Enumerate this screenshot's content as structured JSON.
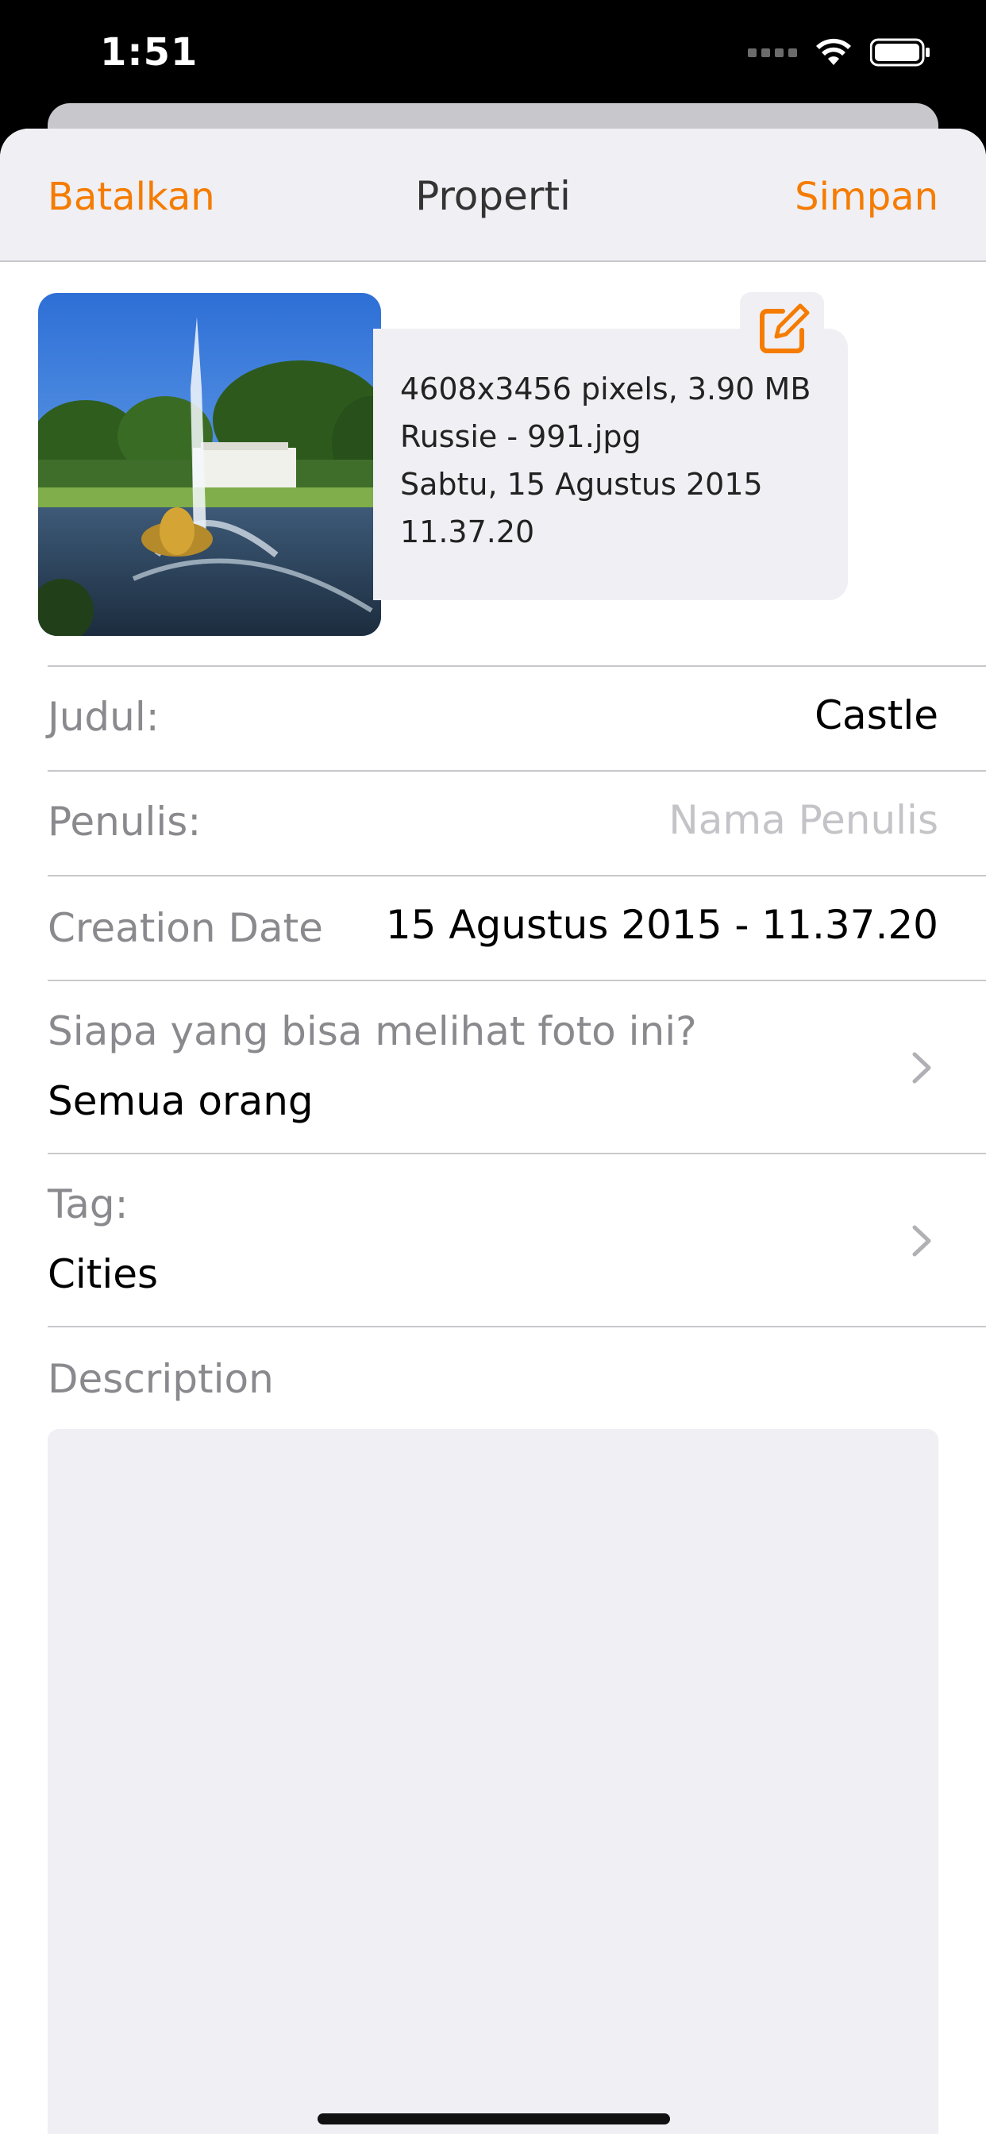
{
  "status_bar": {
    "time": "1:51",
    "icons": [
      "cellular-signal-icon",
      "wifi-icon",
      "battery-icon"
    ]
  },
  "navbar": {
    "cancel_label": "Batalkan",
    "title": "Properti",
    "save_label": "Simpan"
  },
  "photo": {
    "info": [
      "4608x3456 pixels, 3.90 MB",
      "Russie - 991.jpg",
      "Sabtu, 15 Agustus 2015",
      "11.37.20"
    ],
    "edit_icon": "edit-square-icon"
  },
  "fields": {
    "title": {
      "label": "Judul:",
      "value": "Castle"
    },
    "author": {
      "label": "Penulis:",
      "placeholder": "Nama Penulis"
    },
    "creation_date": {
      "label": "Creation Date",
      "value": "15 Agustus 2015 - 11.37.20"
    },
    "visibility": {
      "label": "Siapa yang bisa melihat foto ini?",
      "value": "Semua orang"
    },
    "tags": {
      "label": "Tag:",
      "value": "Cities"
    },
    "description": {
      "label": "Description",
      "value": ""
    }
  },
  "colors": {
    "accent": "#f57c00",
    "nav_background": "#efeff4",
    "label_gray": "#8a8a8e",
    "placeholder_gray": "#c4c4c8",
    "separator": "#c8c8cc"
  }
}
